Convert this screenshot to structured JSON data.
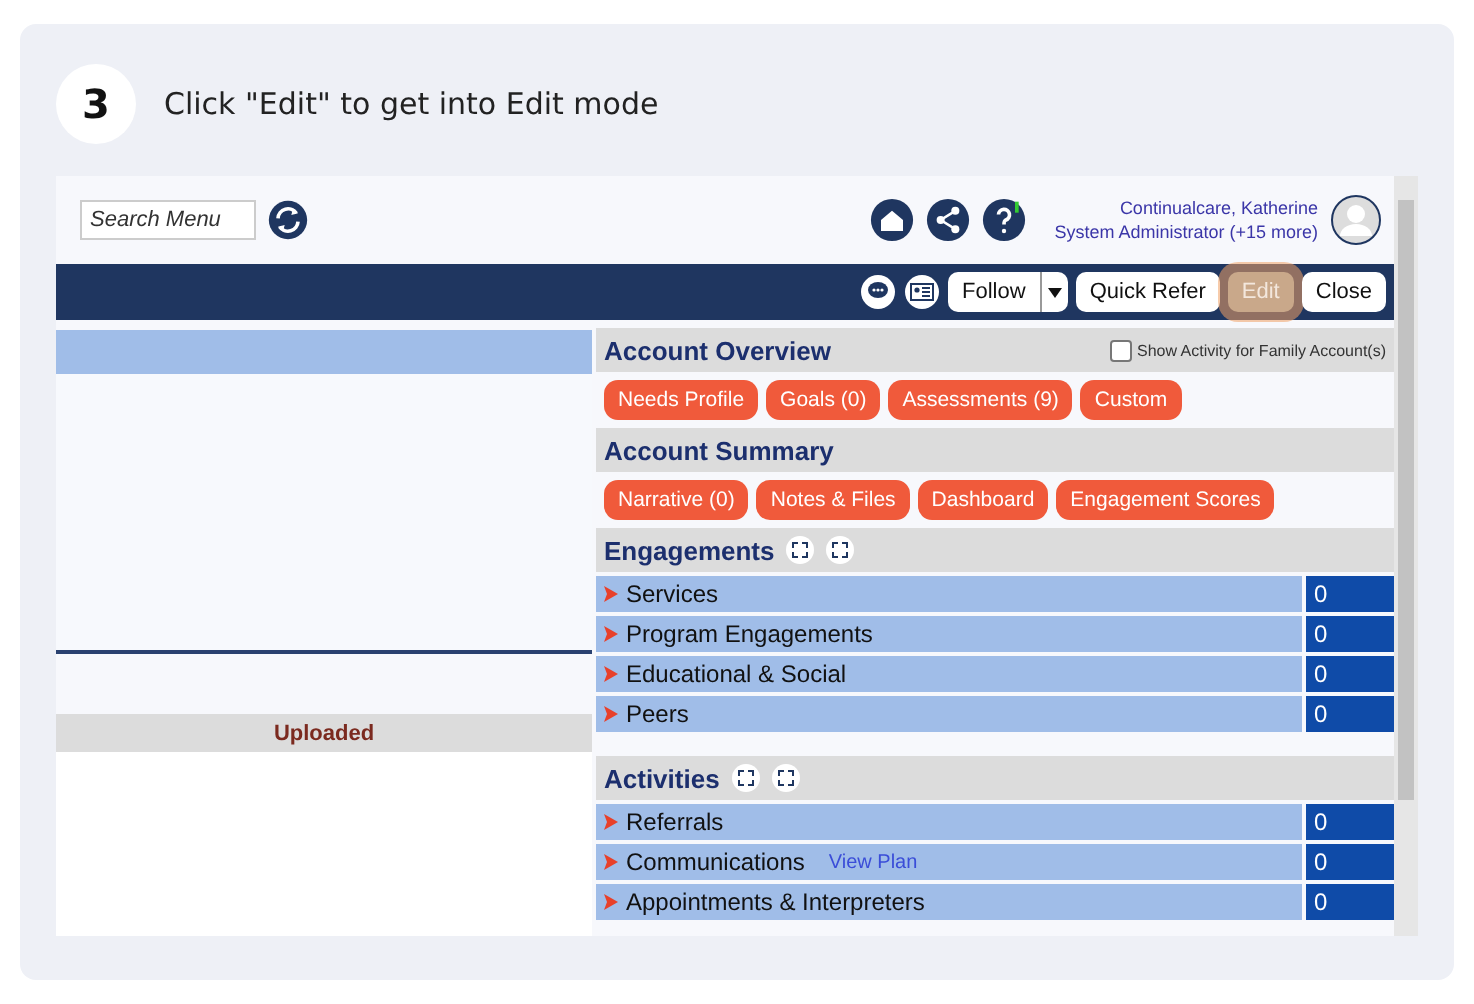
{
  "step": {
    "number": "3",
    "instruction": "Click \"Edit\" to get into Edit mode"
  },
  "top_bar": {
    "search": {
      "placeholder": "Search Menu"
    },
    "user": {
      "name": "Continualcare, Katherine",
      "role": "System Administrator (+15 more)"
    }
  },
  "toolbar": {
    "buttons": [
      {
        "label": "Follow",
        "kind": "split",
        "highlighted": false
      },
      {
        "label": "Quick Refer",
        "kind": "plain",
        "highlighted": false
      },
      {
        "label": "Edit",
        "kind": "plain",
        "highlighted": true
      },
      {
        "label": "Close",
        "kind": "plain",
        "highlighted": false
      }
    ]
  },
  "left_panel": {
    "column_header": "Uploaded"
  },
  "account_overview": {
    "title": "Account Overview",
    "family_checkbox": {
      "label": "Show Activity for Family Account(s)",
      "checked": false
    },
    "pills": [
      "Needs Profile",
      "Goals (0)",
      "Assessments (9)",
      "Custom"
    ]
  },
  "account_summary": {
    "title": "Account Summary",
    "pills": [
      "Narrative (0)",
      "Notes & Files",
      "Dashboard",
      "Engagement Scores"
    ]
  },
  "sections": [
    {
      "title": "Engagements",
      "rows": [
        {
          "label": "Services",
          "count": "0"
        },
        {
          "label": "Program Engagements",
          "count": "0"
        },
        {
          "label": "Educational & Social",
          "count": "0"
        },
        {
          "label": "Peers",
          "count": "0"
        }
      ]
    },
    {
      "title": "Activities",
      "rows": [
        {
          "label": "Referrals",
          "count": "0"
        },
        {
          "label": "Communications",
          "link": "View Plan",
          "count": "0"
        },
        {
          "label": "Appointments & Interpreters",
          "count": "0"
        }
      ]
    }
  ]
}
